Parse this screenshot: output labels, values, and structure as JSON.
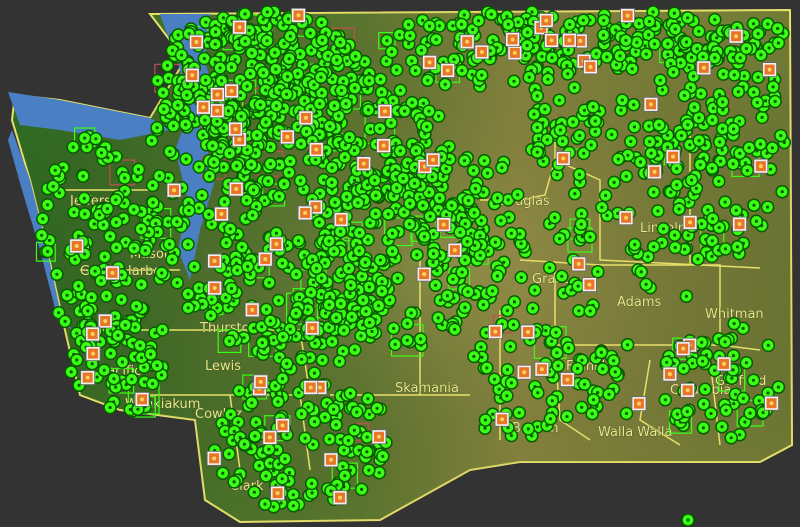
{
  "map": {
    "region": "Washington State",
    "colors": {
      "background": "#333333",
      "water": "#4a7fc4",
      "county_border": "#e6e06a",
      "terrain_west": "#3f7a2c",
      "terrain_east": "#8a8a3c",
      "marker_fill": "#39ff14",
      "marker_ring": "#0a5a00",
      "photo_marker": "#e8762a",
      "photo_frame": "#f2f2f2"
    },
    "county_labels": [
      "Jefferson",
      "Mason",
      "Grays Harbor",
      "Pacific",
      "Wahkiakum",
      "Cowlitz",
      "Clark",
      "Lewis",
      "Thurston",
      "Skamania",
      "Douglas",
      "Grant",
      "Adams",
      "Lincoln",
      "Whitman",
      "Franklin",
      "Benton",
      "Walla Walla",
      "Columbia",
      "Garfield"
    ],
    "marker_types": [
      "observation-marker",
      "photo-marker",
      "cluster-box"
    ]
  }
}
